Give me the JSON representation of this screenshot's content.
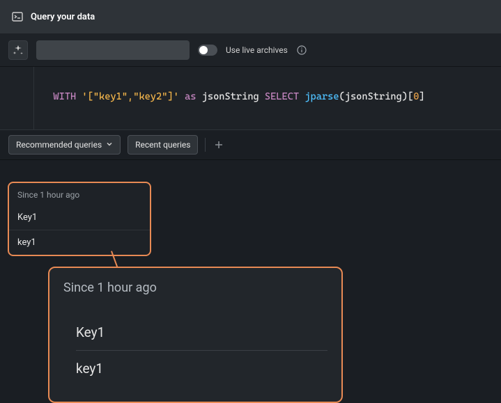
{
  "header": {
    "title": "Query your data"
  },
  "toolbar": {
    "live_archives_label": "Use live archives"
  },
  "query": {
    "with": "WITH",
    "string_literal": "'[\"key1\",\"key2\"]'",
    "as": "as",
    "alias": "jsonString",
    "select": "SELECT",
    "func": "jparse",
    "arg": "jsonString",
    "idx": "0"
  },
  "chips": {
    "recommended": "Recommended queries",
    "recent": "Recent queries"
  },
  "results": {
    "header": "Since 1 hour ago",
    "rows": [
      "Key1",
      "key1"
    ]
  },
  "zoomed": {
    "header": "Since 1 hour ago",
    "rows": [
      "Key1",
      "key1"
    ]
  }
}
